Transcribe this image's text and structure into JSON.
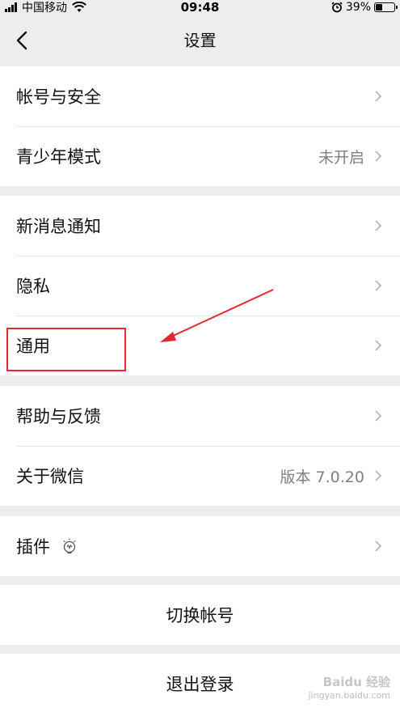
{
  "status_bar": {
    "carrier": "中国移动",
    "time": "09:48",
    "battery": "39%",
    "battery_level": 0.39
  },
  "nav": {
    "title": "设置",
    "back_icon": "chevron-left-icon"
  },
  "groups": [
    [
      {
        "label": "帐号与安全",
        "value": ""
      },
      {
        "label": "青少年模式",
        "value": "未开启"
      }
    ],
    [
      {
        "label": "新消息通知",
        "value": ""
      },
      {
        "label": "隐私",
        "value": ""
      },
      {
        "label": "通用",
        "value": ""
      }
    ],
    [
      {
        "label": "帮助与反馈",
        "value": ""
      },
      {
        "label": "关于微信",
        "value": "版本 7.0.20"
      }
    ],
    [
      {
        "label": "插件",
        "value": ""
      }
    ]
  ],
  "actions": {
    "switch_account": "切换帐号",
    "logout": "退出登录"
  },
  "annotation": {
    "highlight_color": "#e8262d"
  },
  "watermark": {
    "line1": "Baidu 经验",
    "line2": "jingyan.baidu.com"
  }
}
